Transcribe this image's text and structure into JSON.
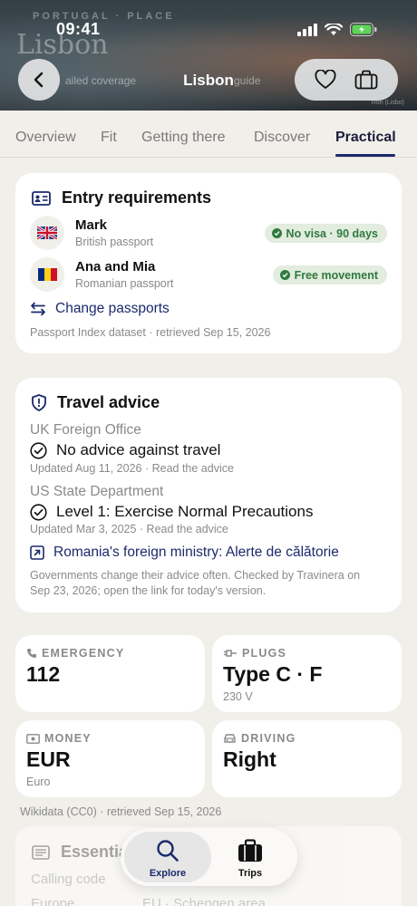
{
  "status_bar": {
    "time": "09:41"
  },
  "header": {
    "title": "Lisbon",
    "background": {
      "eyebrow": "PORTUGAL · PLACE",
      "title": "Lisbon",
      "chip_1": "ailed coverage",
      "chip_2": "guide",
      "note": "Ron (Lisbo)"
    }
  },
  "tabs": [
    {
      "label": "Overview"
    },
    {
      "label": "Fit"
    },
    {
      "label": "Getting there"
    },
    {
      "label": "Discover"
    },
    {
      "label": "Practical"
    }
  ],
  "active_tab": "Practical",
  "entry": {
    "title": "Entry requirements",
    "people": [
      {
        "name": "Mark",
        "passport": "British passport",
        "flag": "uk-flag",
        "status": "No visa · 90 days"
      },
      {
        "name": "Ana and Mia",
        "passport": "Romanian passport",
        "flag": "romania-flag",
        "status": "Free movement"
      }
    ],
    "change_link": "Change passports",
    "source": "Passport Index dataset · retrieved Sep 15, 2026"
  },
  "advice": {
    "title": "Travel advice",
    "items": [
      {
        "source": "UK Foreign Office",
        "level": "No advice against travel",
        "updated": "Updated Aug 11, 2026 · Read the advice"
      },
      {
        "source": "US State Department",
        "level": "Level 1: Exercise Normal Precautions",
        "updated": "Updated Mar 3, 2025 · Read the advice"
      }
    ],
    "ministry_link": "Romania's foreign ministry: Alerte de călătorie",
    "note_line1": "Governments change their advice often. Checked by Travinera on",
    "note_line2": "Sep 23, 2026; open the link for today's version."
  },
  "facts": {
    "emergency": {
      "label": "EMERGENCY",
      "value": "112"
    },
    "plugs": {
      "label": "PLUGS",
      "value": "Type C · F",
      "sub": "230 V"
    },
    "money": {
      "label": "MONEY",
      "value": "EUR",
      "sub": "Euro"
    },
    "driving": {
      "label": "DRIVING",
      "value": "Right"
    },
    "source": "Wikidata (CC0) · retrieved Sep 15, 2026"
  },
  "essentials": {
    "title": "Essentia",
    "row1_label": "Calling code",
    "row2_label": "Europe",
    "row2_value": "EU · Schengen area"
  },
  "bottom_nav": [
    {
      "label": "Explore",
      "icon": "search-icon"
    },
    {
      "label": "Trips",
      "icon": "suitcase-icon"
    }
  ],
  "colors": {
    "accent": "#1b2a6b",
    "success": "#2f7a3e",
    "success_bg": "#e2ecdf",
    "page_bg": "#f1efea"
  }
}
